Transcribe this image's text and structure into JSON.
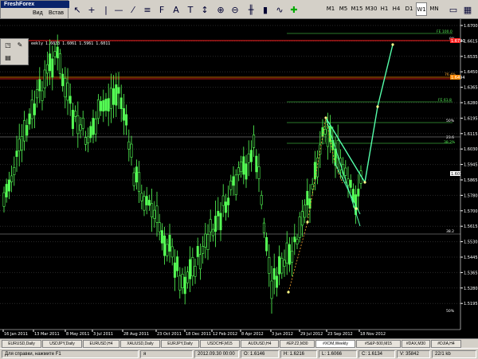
{
  "app": {
    "broker": "FreshForex",
    "menu": [
      "Вид",
      "Встав"
    ]
  },
  "toolbar": {
    "timeframes": [
      "M1",
      "M5",
      "M15",
      "M30",
      "H1",
      "H4",
      "D1",
      "W1",
      "MN"
    ],
    "active_timeframe": "W1"
  },
  "chart": {
    "info": "eekly  1.6033 1.6061 1.5961 1.6011",
    "price_levels": [
      "1.6700",
      "1.6615",
      "1.6535",
      "1.6450",
      "1.6365",
      "1.6280",
      "1.6195",
      "1.6115",
      "1.6030",
      "1.5945",
      "1.5865",
      "1.5780",
      "1.5700",
      "1.5615",
      "1.5530",
      "1.5445",
      "1.5365",
      "1.5280",
      "1.5195"
    ],
    "date_labels": [
      "16 Jan 2011",
      "13 Mar 2011",
      "8 May 2011",
      "3 Jul 2011",
      "28 Aug 2011",
      "23 Oct 2011",
      "18 Dec 2011",
      "12 Feb 2012",
      "8 Apr 2012",
      "3 Jun 2012",
      "29 Jul 2012",
      "23 Sep 2012",
      "18 Nov 2012"
    ],
    "current_price": "1.6011",
    "red_level_top": "1.6731",
    "orange_level": "1.6494",
    "fibo_labels": [
      {
        "text": "FE 100.0",
        "color": "#55ee55"
      },
      {
        "text": "0%",
        "color": "#ffffff"
      },
      {
        "text": "76.4%",
        "color": "#ffaa33"
      },
      {
        "text": "FE 61.8",
        "color": "#55ee55"
      },
      {
        "text": "50%",
        "color": "#ffffff"
      },
      {
        "text": "23.6",
        "color": "#ffffff"
      },
      {
        "text": "38.2%",
        "color": "#55ee55"
      },
      {
        "text": "38.2",
        "color": "#ffffff"
      },
      {
        "text": "50%",
        "color": "#ffffff"
      }
    ],
    "colors": {
      "candle": "#55ff55",
      "background": "#000000",
      "red_line": "#ff2222",
      "orange_line": "#ff8800"
    }
  },
  "symbol_tabs": [
    "EURUSD,Daily",
    "USDJPY,Daily",
    "EURUSD,H4",
    "XAUUSD,Daily",
    "EURJPY,Daily",
    "USDCHF,M15",
    "AUDUSD,H4",
    "#EP.Z2,M30",
    "#XOM,Weekly",
    "#S&P-500,M15",
    "#DAX,M30",
    "#DJIA,H4"
  ],
  "status": {
    "help": "Для справки, нажмите F1",
    "profile": "я",
    "datetime": "2012.09.30 00:00",
    "open": "O: 1.6146",
    "high": "H: 1.6216",
    "low": "L: 1.6066",
    "close": "C: 1.6134",
    "volume": "V: 35842",
    "traffic": "22/1 kb"
  }
}
